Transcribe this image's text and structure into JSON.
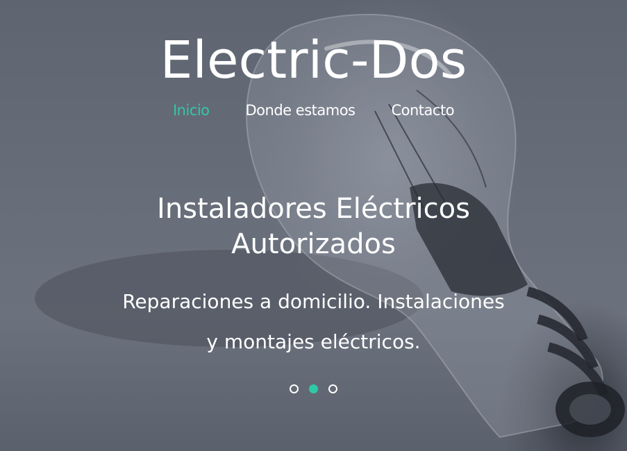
{
  "site": {
    "title": "Electric-Dos"
  },
  "nav": {
    "items": [
      {
        "label": "Inicio",
        "active": true
      },
      {
        "label": "Donde estamos",
        "active": false
      },
      {
        "label": "Contacto",
        "active": false
      }
    ]
  },
  "hero": {
    "headline_line1": "Instaladores Eléctricos",
    "headline_line2": "Autorizados",
    "subtext_line1": "Reparaciones a domicilio. Instalaciones",
    "subtext_line2": "y montajes eléctricos.",
    "background": "light-bulb-image"
  },
  "slider": {
    "slide_count": 3,
    "active_index": 1
  },
  "colors": {
    "accent": "#36c6a8",
    "text": "#ffffff",
    "overlay": "#5e6571"
  }
}
